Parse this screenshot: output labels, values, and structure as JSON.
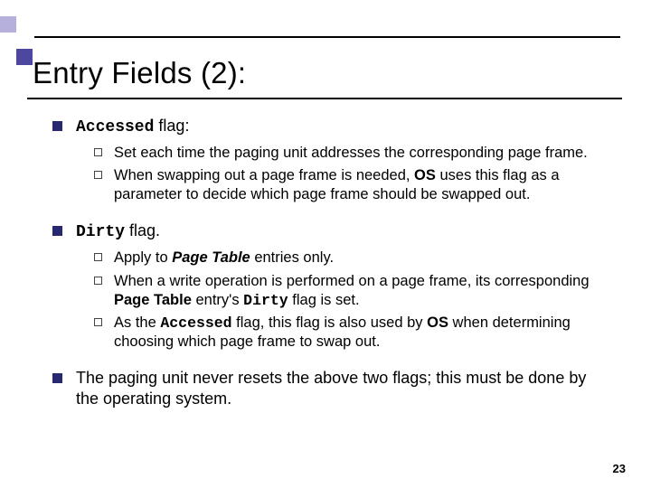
{
  "title": "Entry Fields (2):",
  "items": [
    {
      "label_mono": "Accessed",
      "label_tail": " flag:",
      "subs": [
        {
          "text": "Set each time the paging unit addresses the corresponding page frame."
        },
        {
          "pre": "When swapping out a page frame is needed, ",
          "bold1": "OS",
          "post": " uses this flag as a parameter to decide which page frame should be swapped out."
        }
      ]
    },
    {
      "label_mono": "Dirty",
      "label_tail": " flag.",
      "subs": [
        {
          "pre": "Apply to ",
          "bi": "Page Table",
          "post": " entries only."
        },
        {
          "pre": "When a write operation is performed on a page frame, its corresponding ",
          "bold1": "Page Table",
          "mid": " entry's ",
          "mono": "Dirty",
          "post": " flag is set."
        },
        {
          "pre": "As the ",
          "mono": "Accessed",
          "mid": " flag, this flag is also used by ",
          "bold1": "OS",
          "post": " when determining choosing which page frame to swap out."
        }
      ]
    },
    {
      "plain": "The paging unit never resets the above two flags; this must be done by the operating system."
    }
  ],
  "page_number": "23"
}
